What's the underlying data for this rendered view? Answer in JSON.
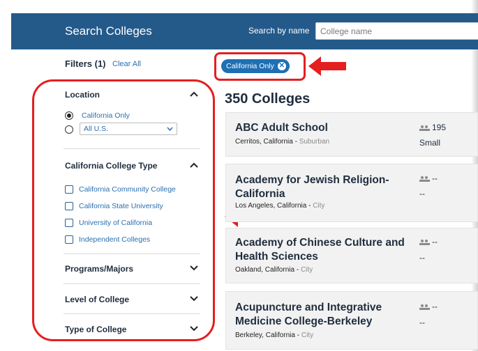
{
  "header": {
    "title": "Search Colleges",
    "search_label": "Search by name",
    "search_placeholder": "College name"
  },
  "filters": {
    "heading": "Filters (1)",
    "clear_all": "Clear All",
    "location": {
      "title": "Location",
      "options": [
        "California Only"
      ],
      "select_value": "All U.S."
    },
    "college_type": {
      "title": "California College Type",
      "options": [
        "California Community College",
        "California State University",
        "University of California",
        "Independent Colleges"
      ]
    },
    "collapsed": [
      "Programs/Majors",
      "Level of College",
      "Type of College"
    ]
  },
  "active_chip": "California Only",
  "results": {
    "count": "350 Colleges",
    "cards": [
      {
        "name": "ABC Adult School",
        "city": "Cerritos, California",
        "setting": "Suburban",
        "enrollment": "195",
        "size": "Small"
      },
      {
        "name": "Academy for Jewish Religion-California",
        "city": "Los Angeles, California",
        "setting": "City",
        "enrollment": "--",
        "size": "--"
      },
      {
        "name": "Academy of Chinese Culture and Health Sciences",
        "city": "Oakland, California",
        "setting": "City",
        "enrollment": "--",
        "size": "--"
      },
      {
        "name": "Acupuncture and Integrative Medicine College-Berkeley",
        "city": "Berkeley, California",
        "setting": "City",
        "enrollment": "--",
        "size": "--"
      }
    ]
  },
  "colors": {
    "header_bg": "#245a8a",
    "link": "#2a6fb0",
    "chip_bg": "#1f6fb3",
    "annotation_red": "#e41f1f"
  }
}
